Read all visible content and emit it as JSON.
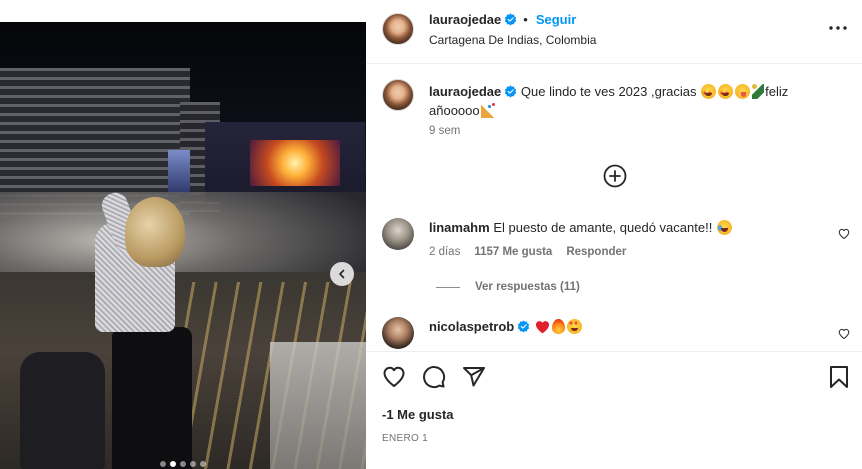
{
  "post": {
    "image_dots": 5,
    "active_dot": 1,
    "author": {
      "username": "lauraojedae",
      "verified": true,
      "follow_label": "Seguir",
      "separator": "•",
      "location": "Cartagena De Indias, Colombia"
    },
    "caption": {
      "username": "lauraojedae",
      "text": "Que lindo te ves 2023 ,gracias",
      "text_after": "feliz añooooo",
      "emojis": [
        "star-struck-emoji",
        "star-struck-emoji",
        "yum-emoji",
        "champagne-emoji",
        "party-popper-emoji"
      ],
      "time": "9 sem"
    },
    "comments": [
      {
        "username": "linamahm",
        "verified": false,
        "text": "El puesto de amante, quedó vacante!!",
        "emoji": "laughing-tears-emoji",
        "time": "2 días",
        "likes": "1157 Me gusta",
        "reply_label": "Responder",
        "view_replies": "Ver respuestas (11)"
      },
      {
        "username": "nicolaspetrob",
        "verified": true,
        "text": "",
        "emojis": [
          "red-heart-emoji",
          "fire-emoji",
          "star-struck-emoji"
        ]
      }
    ],
    "likes_label": "-1 Me gusta",
    "date": "ENERO 1"
  },
  "colors": {
    "accent_blue": "#0095f6",
    "verified_blue": "#0095f6",
    "text": "#262626",
    "secondary_text": "#737373",
    "divider": "#efefef"
  }
}
